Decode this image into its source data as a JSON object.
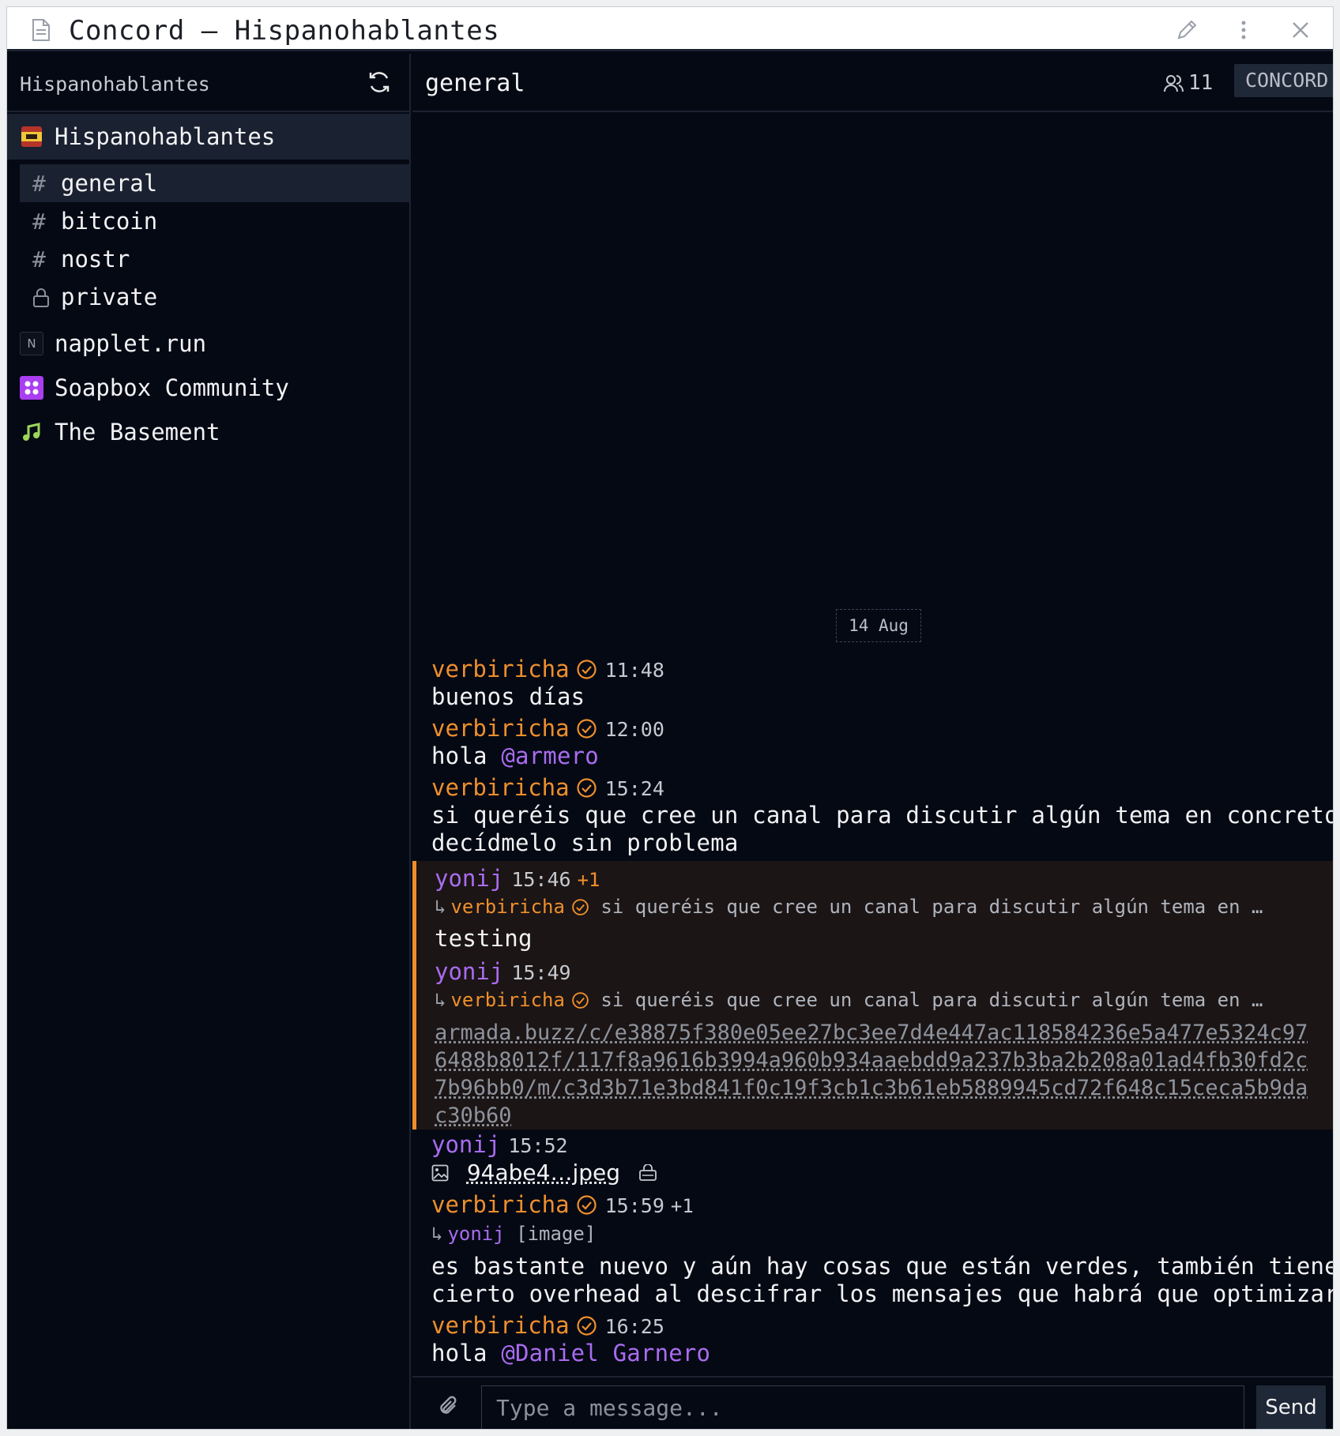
{
  "window": {
    "title": "Concord — Hispanohablantes"
  },
  "sidebar": {
    "header": "Hispanohablantes",
    "active_group": "Hispanohablantes",
    "channels": [
      {
        "label": "general",
        "icon": "hash"
      },
      {
        "label": "bitcoin",
        "icon": "hash"
      },
      {
        "label": "nostr",
        "icon": "hash"
      },
      {
        "label": "private",
        "icon": "lock"
      }
    ],
    "other_groups": [
      {
        "label": "napplet.run",
        "icon_text": "N"
      },
      {
        "label": "Soapbox Community"
      },
      {
        "label": "The Basement"
      }
    ]
  },
  "channel": {
    "name": "general",
    "member_count": "11",
    "badge": "CONCORD",
    "date_divider": "14 Aug"
  },
  "messages": [
    {
      "author": "verbiricha",
      "time": "11:48",
      "text": "buenos días"
    },
    {
      "author": "verbiricha",
      "time": "12:00",
      "text": "hola ",
      "mention": "@armero"
    },
    {
      "author": "verbiricha",
      "time": "15:24",
      "text_line1": "si queréis que cree un canal para discutir algún tema en concreto",
      "text_line2": "decídmelo sin problema"
    },
    {
      "author": "yonij",
      "time": "15:46",
      "reaction": "+1",
      "reply_author": "verbiricha",
      "reply_text": "si queréis que cree un canal para discutir algún tema en …",
      "text": "testing"
    },
    {
      "author": "yonij",
      "time": "15:49",
      "reply_author": "verbiricha",
      "reply_text": "si queréis que cree un canal para discutir algún tema en …",
      "link": "armada.buzz/c/e38875f380e05ee27bc3ee7d4e447ac118584236e5a477e5324c976488b8012f/117f8a9616b3994a960b934aaebdd9a237b3ba2b208a01ad4fb30fd2c7b96bb0/m/c3d3b71e3bd841f0c19f3cb1c3b61eb5889945cd72f648c15ceca5b9dac30b60"
    },
    {
      "author": "yonij",
      "time": "15:52",
      "file": "94abe4…jpeg"
    },
    {
      "author": "verbiricha",
      "time": "15:59",
      "reaction": "+1",
      "reply_author": "yonij",
      "reply_text": "[image]",
      "text_line1": "es bastante nuevo y aún hay cosas que están verdes, también tiene",
      "text_line2": "cierto overhead al descifrar los mensajes que habrá que optimizar"
    },
    {
      "author": "verbiricha",
      "time": "16:25",
      "text": "hola ",
      "mention": "@Daniel Garnero"
    }
  ],
  "composer": {
    "placeholder": "Type a message...",
    "send_label": "Send"
  },
  "colors": {
    "accent_orange": "#ef8f2c",
    "accent_purple": "#a96cf0",
    "background": "#050914"
  }
}
